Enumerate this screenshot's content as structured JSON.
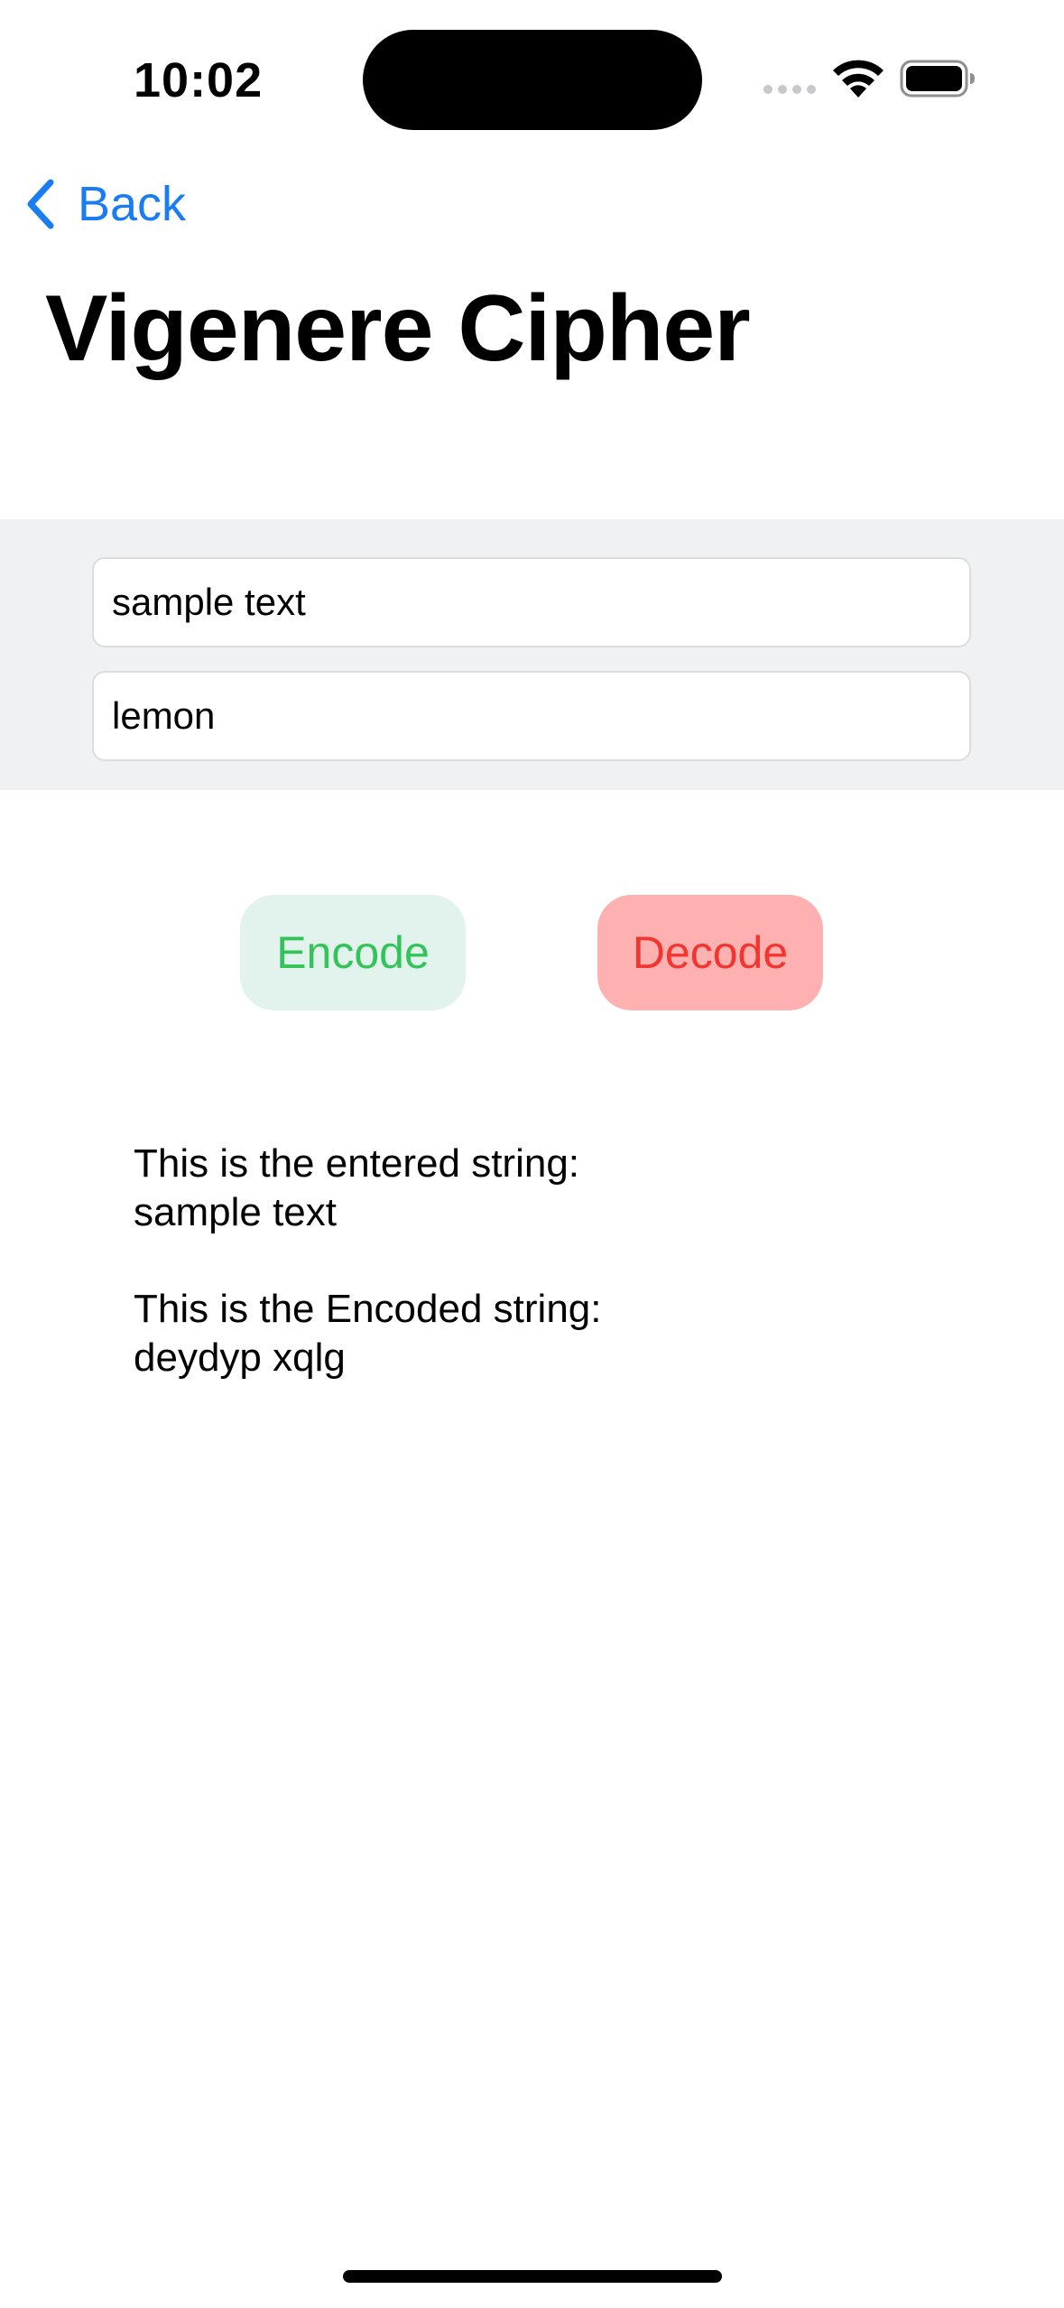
{
  "status_bar": {
    "time": "10:02"
  },
  "nav": {
    "back_label": "Back"
  },
  "page": {
    "title": "Vigenere Cipher"
  },
  "form": {
    "text_input_value": "sample text",
    "key_input_value": "lemon"
  },
  "actions": {
    "encode_label": "Encode",
    "decode_label": "Decode"
  },
  "output": {
    "entered_heading": "This is the entered string:",
    "entered_value": "sample text",
    "encoded_heading": "This is the Encoded string:",
    "encoded_value": "deydyp xqlg"
  },
  "colors": {
    "accent_blue": "#1a7cf2",
    "encode_text": "#33c459",
    "encode_bg": "#e2f3ee",
    "decode_text": "#f2352e",
    "decode_bg": "#ffb0b0",
    "form_bg": "#f0f1f3"
  },
  "icons": {
    "back": "chevron-left-icon",
    "wifi": "wifi-icon",
    "battery": "battery-icon",
    "signal": "signal-dots-icon"
  }
}
